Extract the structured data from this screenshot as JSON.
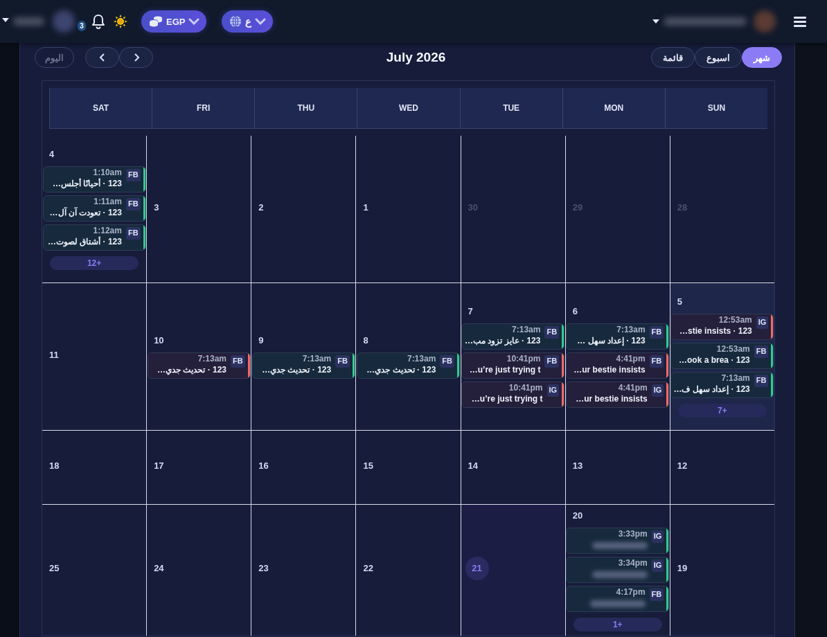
{
  "topbar": {
    "notifications": "3",
    "currency": "EGP",
    "language": "ع"
  },
  "toolbar": {
    "today": {
      "label": "اليوم",
      "disabled": true
    },
    "title": "July 2026",
    "views": [
      {
        "label": "شهر",
        "selected": true
      },
      {
        "label": "اسبوع",
        "selected": false
      },
      {
        "label": "قائمة",
        "selected": false
      }
    ]
  },
  "weekdays": [
    "SAT",
    "FRI",
    "THU",
    "WED",
    "TUE",
    "MON",
    "SUN"
  ],
  "weeks": [
    {
      "days": [
        {
          "label": "4",
          "muted": false,
          "today": false,
          "selected": false,
          "more": "12+",
          "events": [
            {
              "badge": "FB",
              "time": "1:10am",
              "title": "123 · أحيانًا أجلس…",
              "color": "#2ecc8f"
            },
            {
              "badge": "FB",
              "time": "1:11am",
              "title": "123 · تعودت آن آل…",
              "color": "#2ecc8f"
            },
            {
              "badge": "FB",
              "time": "1:12am",
              "title": "123 · أشتاق لصوت…",
              "color": "#2ecc8f"
            }
          ]
        },
        {
          "label": "3",
          "muted": false,
          "today": false,
          "selected": false
        },
        {
          "label": "2",
          "muted": false,
          "today": false,
          "selected": false
        },
        {
          "label": "1",
          "muted": false,
          "today": false,
          "selected": false
        },
        {
          "label": "30",
          "muted": true,
          "today": false,
          "selected": false
        },
        {
          "label": "29",
          "muted": true,
          "today": false,
          "selected": false
        },
        {
          "label": "28",
          "muted": true,
          "today": false,
          "selected": false
        }
      ]
    },
    {
      "days": [
        {
          "label": "11",
          "muted": false,
          "today": false,
          "selected": false
        },
        {
          "label": "10",
          "muted": false,
          "today": false,
          "selected": false,
          "events": [
            {
              "badge": "FB",
              "time": "7:13am",
              "title": "123 · تحديث جدي…",
              "color": "#f06a6a"
            }
          ]
        },
        {
          "label": "9",
          "muted": false,
          "today": false,
          "selected": false,
          "events": [
            {
              "badge": "FB",
              "time": "7:13am",
              "title": "123 · تحديث جدي…",
              "color": "#2ecc8f"
            }
          ]
        },
        {
          "label": "8",
          "muted": false,
          "today": false,
          "selected": false,
          "events": [
            {
              "badge": "FB",
              "time": "7:13am",
              "title": "123 · تحديث جدي…",
              "color": "#2ecc8f"
            }
          ]
        },
        {
          "label": "7",
          "muted": false,
          "today": false,
          "selected": false,
          "events": [
            {
              "badge": "FB",
              "time": "7:13am",
              "title": "123 · عايز تزود مب…",
              "color": "#2ecc8f"
            },
            {
              "badge": "FB",
              "time": "10:41pm",
              "title": "u’re just trying t…",
              "color": "#f06a6a"
            },
            {
              "badge": "IG",
              "time": "10:41pm",
              "title": "u’re just trying t…",
              "color": "#f06a6a"
            }
          ]
        },
        {
          "label": "6",
          "muted": false,
          "today": false,
          "selected": false,
          "events": [
            {
              "badge": "FB",
              "time": "7:13am",
              "title": "123 · إعداد سهل …",
              "color": "#2ecc8f"
            },
            {
              "badge": "FB",
              "time": "4:41pm",
              "title": "ur bestie insists…",
              "color": "#f06a6a"
            },
            {
              "badge": "IG",
              "time": "4:41pm",
              "title": "ur bestie insists…",
              "color": "#f06a6a"
            }
          ]
        },
        {
          "label": "5",
          "muted": false,
          "today": false,
          "selected": true,
          "more": "7+",
          "events": [
            {
              "badge": "IG",
              "time": "12:53am",
              "title": "123 · stie insists…",
              "color": "#f06a6a"
            },
            {
              "badge": "FB",
              "time": "12:53am",
              "title": "123 · ook a brea…",
              "color": "#2ecc8f"
            },
            {
              "badge": "FB",
              "time": "7:13am",
              "title": "123 · إعداد سهل ف…",
              "color": "#2ecc8f"
            }
          ]
        }
      ]
    },
    {
      "days": [
        {
          "label": "18",
          "muted": false,
          "today": false,
          "selected": false
        },
        {
          "label": "17",
          "muted": false,
          "today": false,
          "selected": false
        },
        {
          "label": "16",
          "muted": false,
          "today": false,
          "selected": false
        },
        {
          "label": "15",
          "muted": false,
          "today": false,
          "selected": false
        },
        {
          "label": "14",
          "muted": false,
          "today": false,
          "selected": false
        },
        {
          "label": "13",
          "muted": false,
          "today": false,
          "selected": false
        },
        {
          "label": "12",
          "muted": false,
          "today": false,
          "selected": false
        }
      ]
    },
    {
      "days": [
        {
          "label": "25",
          "muted": false,
          "today": false,
          "selected": false
        },
        {
          "label": "24",
          "muted": false,
          "today": false,
          "selected": false
        },
        {
          "label": "23",
          "muted": false,
          "today": false,
          "selected": false
        },
        {
          "label": "22",
          "muted": false,
          "today": false,
          "selected": false
        },
        {
          "label": "21",
          "muted": false,
          "today": true,
          "selected": false
        },
        {
          "label": "20",
          "muted": false,
          "today": false,
          "selected": false,
          "more": "1+",
          "events": [
            {
              "badge": "IG",
              "time": "3:33pm",
              "color": "#2ecc8f"
            },
            {
              "badge": "IG",
              "time": "3:34pm",
              "color": "#2ecc8f"
            },
            {
              "badge": "FB",
              "time": "4:17pm",
              "color": "#2ecc8f"
            }
          ]
        },
        {
          "label": "19",
          "muted": false,
          "today": false,
          "selected": false
        }
      ]
    }
  ]
}
